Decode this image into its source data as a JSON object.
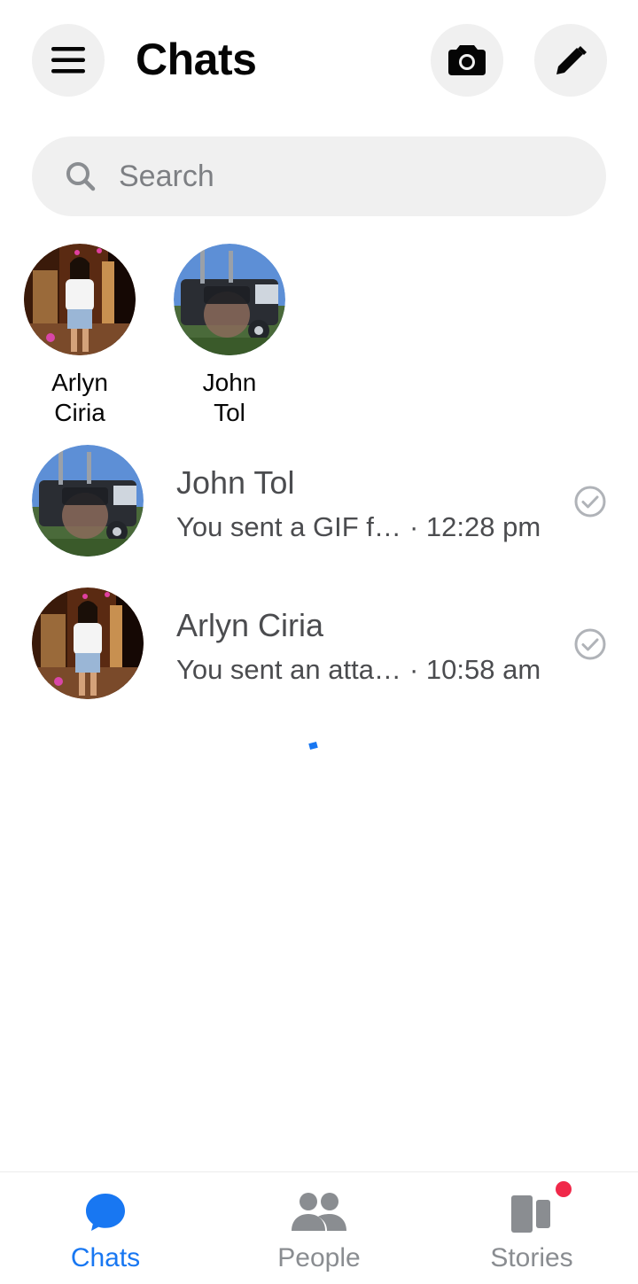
{
  "header": {
    "title": "Chats"
  },
  "search": {
    "placeholder": "Search"
  },
  "active_now": [
    {
      "first": "Arlyn",
      "last": "Ciria"
    },
    {
      "first": "John",
      "last": "Tol"
    }
  ],
  "chats": [
    {
      "name": "John Tol",
      "preview": "You sent a GIF f…",
      "time": "· 12:28 pm"
    },
    {
      "name": "Arlyn Ciria",
      "preview": "You sent an atta…",
      "time": "· 10:58 am"
    }
  ],
  "bottom_nav": {
    "chats": "Chats",
    "people": "People",
    "stories": "Stories"
  },
  "colors": {
    "accent": "#1877f2",
    "notification": "#f02849",
    "muted": "#8a8d91"
  },
  "icons": {
    "menu": "hamburger-icon",
    "camera": "camera-icon",
    "compose": "pencil-icon",
    "search": "search-icon",
    "read": "check-circle-icon"
  }
}
